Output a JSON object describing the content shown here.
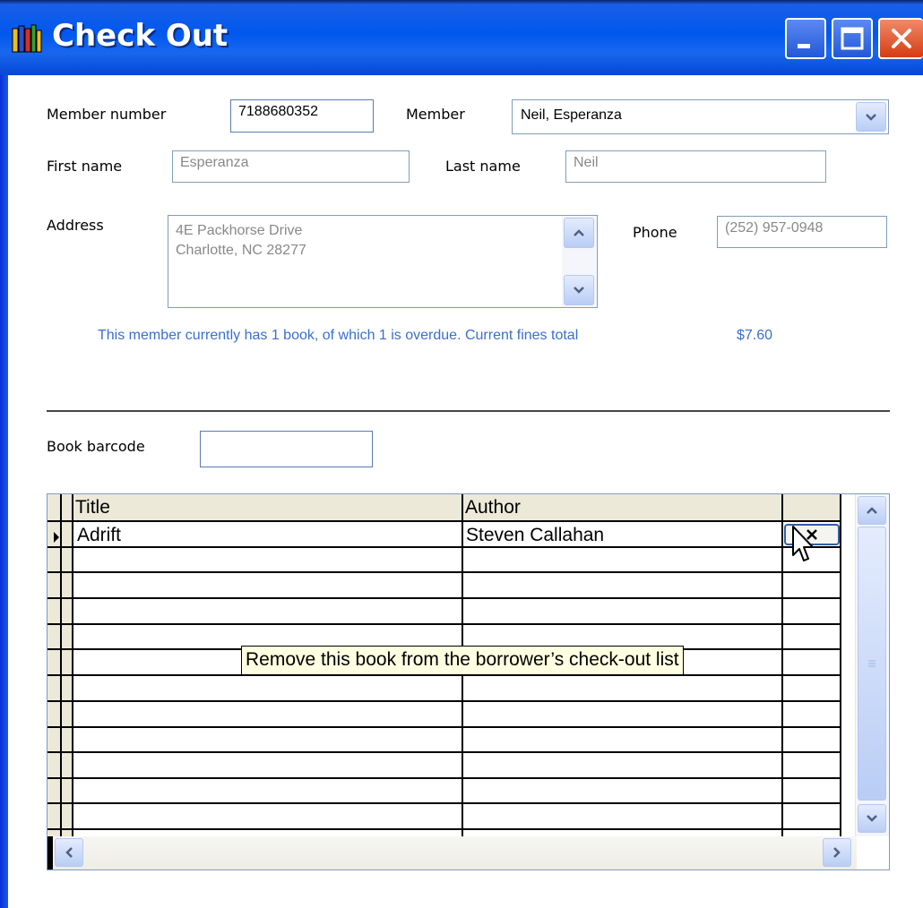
{
  "window": {
    "title": "Check Out",
    "app_icon": "library-books-icon",
    "buttons": {
      "minimize": "minimize-icon",
      "maximize": "maximize-icon",
      "close": "close-icon"
    }
  },
  "member": {
    "member_number_label": "Member number",
    "member_number_value": "7188680352",
    "member_label": "Member",
    "member_value": "Neil, Esperanza",
    "first_name_label": "First name",
    "first_name_value": "Esperanza",
    "last_name_label": "Last name",
    "last_name_value": "Neil",
    "address_label": "Address",
    "address_line1": "4E Packhorse Drive",
    "address_line2": "Charlotte, NC 28277",
    "phone_label": "Phone",
    "phone_value": "(252) 957-0948",
    "status_text": "This member currently has 1 book, of which 1 is overdue. Current fines total",
    "fines_total": "$7.60"
  },
  "checkout": {
    "barcode_label": "Book barcode",
    "barcode_value": "",
    "columns": [
      "Title",
      "Author"
    ],
    "rows": [
      {
        "title": "Adrift",
        "author": "Steven Callahan"
      }
    ],
    "remove_tooltip": "Remove this book from the borrower’s check-out list"
  },
  "colors": {
    "title_bar": "#0058ee",
    "info_text": "#3a6fd0",
    "tooltip_bg": "#ffffe1"
  }
}
